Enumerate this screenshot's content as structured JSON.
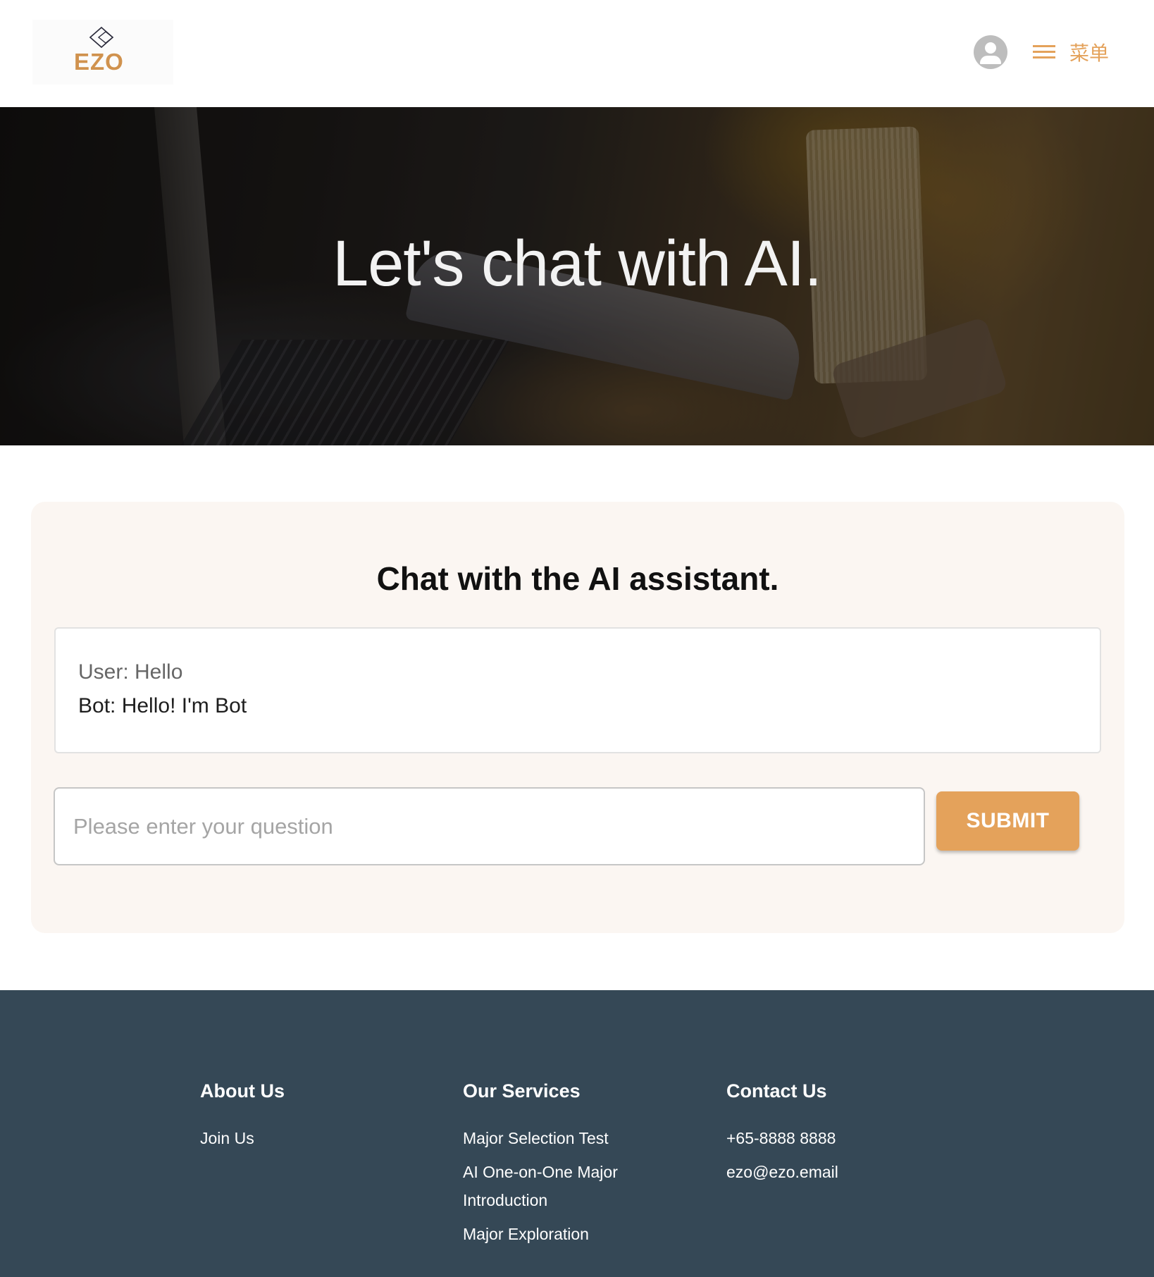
{
  "header": {
    "logo_text": "EZO",
    "avatar_icon": "user-avatar-icon",
    "menu_icon": "hamburger-menu-icon",
    "menu_label": "菜单",
    "accent_color": "#E4A25B"
  },
  "hero": {
    "title": "Let's chat with AI."
  },
  "chat": {
    "title": "Chat with the AI assistant.",
    "messages": [
      {
        "role": "user",
        "text": "User: Hello"
      },
      {
        "role": "bot",
        "text": "Bot: Hello! I'm Bot"
      }
    ],
    "input": {
      "value": "",
      "placeholder": "Please enter your question"
    },
    "submit_label": "SUBMIT",
    "card_bg": "#FBF6F2"
  },
  "footer": {
    "bg_color": "#354856",
    "columns": [
      {
        "heading": "About Us",
        "links": [
          "Join Us"
        ]
      },
      {
        "heading": "Our Services",
        "links": [
          "Major Selection Test",
          "AI One-on-One Major Introduction",
          "Major Exploration"
        ]
      },
      {
        "heading": "Contact Us",
        "links": [
          "+65-8888 8888",
          "ezo@ezo.email"
        ]
      }
    ]
  }
}
